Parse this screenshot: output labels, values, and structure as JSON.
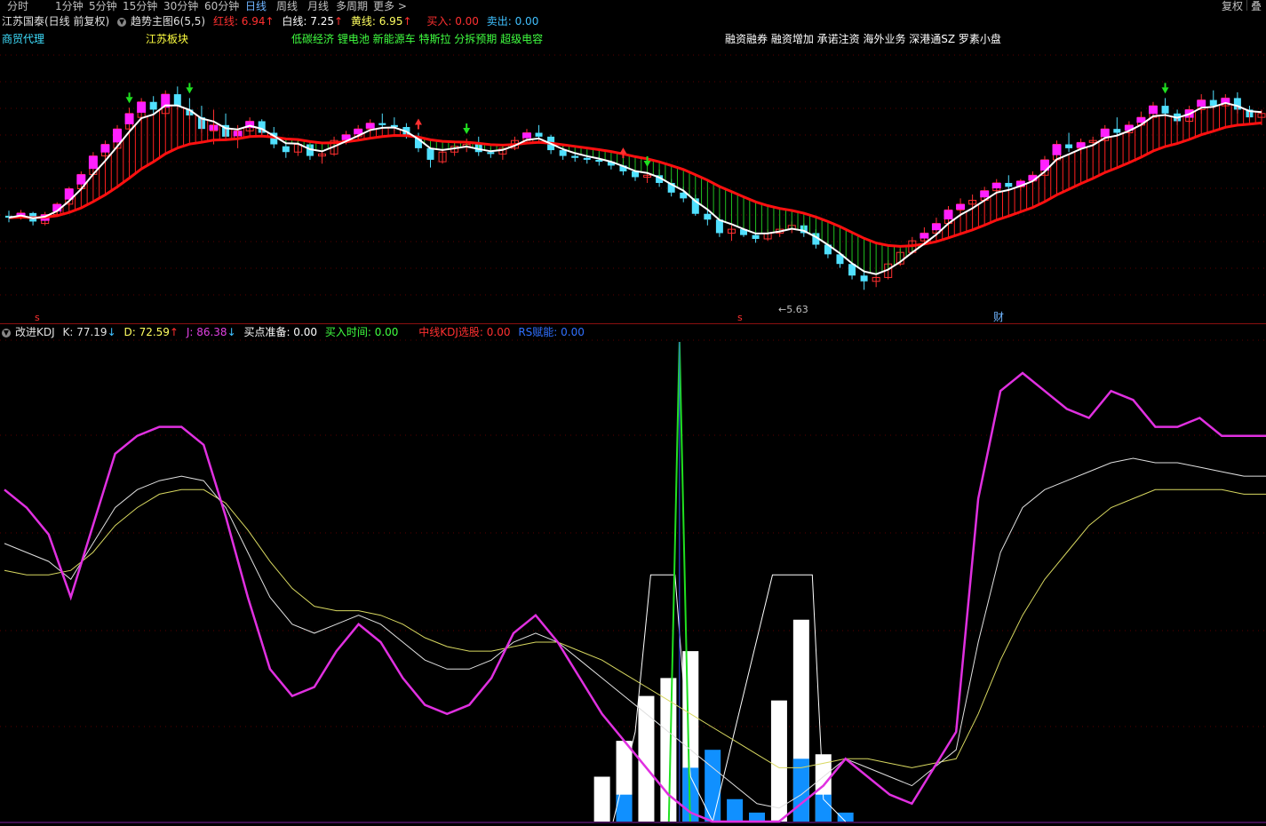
{
  "toolbar": {
    "periods": [
      "分时",
      "1分钟",
      "5分钟",
      "15分钟",
      "30分钟",
      "60分钟",
      "日线",
      "周线",
      "月线",
      "多周期",
      "更多 >"
    ],
    "active_index": 6,
    "right_buttons": [
      "复权",
      "叠"
    ]
  },
  "main": {
    "stock_title": "江苏国泰(日线 前复权)",
    "indicator_name": "趋势主图6(5,5)",
    "red_label": "红线: 6.94",
    "white_label": "白线: 7.25",
    "yellow_label": "黄线: 6.95",
    "buy_label": "买入: 0.00",
    "sell_label": "卖出: 0.00",
    "tags": [
      {
        "text": "商贸代理",
        "color": "#3fe0ff"
      },
      {
        "text": "江苏板块",
        "color": "#ffff40"
      },
      {
        "text": "低碳经济 锂电池 新能源车 特斯拉 分拆预期 超级电容",
        "color": "#40ff40"
      },
      {
        "text": "融资融券 融资增加 承诺注资 海外业务 深港通SZ 罗素小盘",
        "color": "#ffffff"
      }
    ],
    "low_price_label": "←5.63",
    "s_marks": [
      "s",
      "s"
    ],
    "cai_mark": "财"
  },
  "sub": {
    "indicator_name": "改进KDJ",
    "k_label": "K: 77.19",
    "d_label": "D: 72.59",
    "j_label": "J: 86.38",
    "buy_prep_label": "买点准备: 0.00",
    "buy_time_label": "买入时间: 0.00",
    "mid_kdj_label": "中线KDJ选股: 0.00",
    "rs_label": "RS赋能: 0.00"
  },
  "colors": {
    "up": "#ff3030",
    "down": "#50e0ff",
    "white_line": "#ffffff",
    "red_ma": "#ff1010",
    "magenta": "#ff20ff",
    "j_line": "#e030e0",
    "d_line": "#d8d860",
    "k_line": "#e0e0e0",
    "blue_bar": "#1090ff",
    "green_spike": "#20e020"
  },
  "chart_data": {
    "type": "candlestick",
    "ohlc": [
      [
        7.55,
        7.68,
        7.38,
        7.5
      ],
      [
        7.5,
        7.7,
        7.45,
        7.62
      ],
      [
        7.62,
        7.65,
        7.3,
        7.4
      ],
      [
        7.35,
        7.65,
        7.3,
        7.58
      ],
      [
        7.58,
        7.9,
        7.52,
        7.85
      ],
      [
        7.85,
        8.3,
        7.8,
        8.25
      ],
      [
        8.25,
        8.7,
        8.2,
        8.62
      ],
      [
        8.62,
        9.2,
        8.55,
        9.1
      ],
      [
        9.1,
        9.5,
        8.9,
        9.4
      ],
      [
        9.3,
        9.9,
        9.2,
        9.8
      ],
      [
        9.8,
        10.35,
        9.7,
        10.2
      ],
      [
        10.1,
        10.6,
        9.95,
        10.5
      ],
      [
        10.5,
        10.65,
        10.2,
        10.3
      ],
      [
        10.2,
        10.8,
        10.1,
        10.7
      ],
      [
        10.7,
        10.9,
        10.3,
        10.4
      ],
      [
        10.3,
        10.6,
        10.05,
        10.15
      ],
      [
        10.1,
        10.4,
        9.7,
        9.8
      ],
      [
        9.75,
        10.3,
        9.4,
        9.9
      ],
      [
        9.9,
        10.2,
        9.5,
        9.6
      ],
      [
        9.55,
        9.9,
        9.3,
        9.75
      ],
      [
        9.75,
        10.1,
        9.7,
        10.0
      ],
      [
        10.0,
        10.05,
        9.6,
        9.7
      ],
      [
        9.7,
        9.85,
        9.3,
        9.4
      ],
      [
        9.35,
        9.5,
        9.05,
        9.2
      ],
      [
        9.2,
        9.55,
        9.1,
        9.4
      ],
      [
        9.4,
        9.45,
        9.0,
        9.1
      ],
      [
        9.1,
        9.25,
        8.9,
        9.15
      ],
      [
        9.15,
        9.6,
        9.1,
        9.5
      ],
      [
        9.5,
        9.75,
        9.4,
        9.65
      ],
      [
        9.6,
        9.9,
        9.55,
        9.8
      ],
      [
        9.8,
        10.05,
        9.7,
        9.95
      ],
      [
        9.95,
        10.2,
        9.8,
        9.9
      ],
      [
        9.9,
        10.1,
        9.75,
        9.85
      ],
      [
        9.85,
        9.95,
        9.55,
        9.6
      ],
      [
        9.6,
        9.7,
        9.2,
        9.3
      ],
      [
        9.3,
        9.45,
        8.8,
        9.0
      ],
      [
        8.95,
        9.3,
        8.9,
        9.2
      ],
      [
        9.2,
        9.45,
        9.1,
        9.35
      ],
      [
        9.35,
        9.55,
        9.2,
        9.4
      ],
      [
        9.4,
        9.6,
        9.1,
        9.2
      ],
      [
        9.2,
        9.3,
        9.05,
        9.15
      ],
      [
        9.15,
        9.35,
        9.0,
        9.3
      ],
      [
        9.3,
        9.6,
        9.25,
        9.5
      ],
      [
        9.5,
        9.8,
        9.45,
        9.7
      ],
      [
        9.7,
        9.9,
        9.55,
        9.6
      ],
      [
        9.6,
        9.65,
        9.15,
        9.25
      ],
      [
        9.25,
        9.35,
        9.0,
        9.1
      ],
      [
        9.1,
        9.2,
        8.95,
        9.05
      ],
      [
        9.05,
        9.15,
        8.9,
        9.0
      ],
      [
        9.0,
        9.1,
        8.85,
        8.95
      ],
      [
        8.95,
        9.0,
        8.75,
        8.85
      ],
      [
        8.85,
        8.95,
        8.6,
        8.7
      ],
      [
        8.7,
        8.8,
        8.45,
        8.55
      ],
      [
        8.55,
        8.7,
        8.4,
        8.6
      ],
      [
        8.6,
        8.75,
        8.3,
        8.4
      ],
      [
        8.4,
        8.5,
        8.05,
        8.15
      ],
      [
        8.15,
        8.3,
        7.9,
        8.0
      ],
      [
        8.0,
        8.1,
        7.55,
        7.6
      ],
      [
        7.6,
        7.7,
        7.3,
        7.45
      ],
      [
        7.45,
        7.6,
        7.0,
        7.1
      ],
      [
        7.1,
        7.3,
        6.9,
        7.2
      ],
      [
        7.2,
        7.4,
        7.0,
        7.05
      ],
      [
        7.05,
        7.15,
        6.85,
        6.95
      ],
      [
        6.95,
        7.2,
        6.9,
        7.1
      ],
      [
        7.1,
        7.3,
        7.0,
        7.2
      ],
      [
        7.2,
        7.4,
        7.1,
        7.3
      ],
      [
        7.3,
        7.35,
        7.0,
        7.1
      ],
      [
        7.1,
        7.2,
        6.7,
        6.8
      ],
      [
        6.8,
        6.9,
        6.45,
        6.55
      ],
      [
        6.55,
        6.7,
        6.2,
        6.3
      ],
      [
        6.3,
        6.4,
        5.9,
        6.0
      ],
      [
        6.0,
        6.15,
        5.63,
        5.85
      ],
      [
        5.85,
        6.0,
        5.7,
        5.95
      ],
      [
        5.95,
        6.4,
        5.9,
        6.3
      ],
      [
        6.3,
        6.7,
        6.25,
        6.6
      ],
      [
        6.6,
        7.0,
        6.55,
        6.9
      ],
      [
        6.9,
        7.25,
        6.85,
        7.1
      ],
      [
        7.1,
        7.5,
        7.0,
        7.35
      ],
      [
        7.35,
        7.8,
        7.3,
        7.7
      ],
      [
        7.7,
        8.0,
        7.55,
        7.85
      ],
      [
        7.85,
        8.1,
        7.7,
        7.95
      ],
      [
        7.95,
        8.3,
        7.9,
        8.2
      ],
      [
        8.2,
        8.5,
        8.1,
        8.4
      ],
      [
        8.4,
        8.6,
        8.2,
        8.3
      ],
      [
        8.3,
        8.5,
        8.2,
        8.45
      ],
      [
        8.45,
        8.7,
        8.35,
        8.6
      ],
      [
        8.6,
        9.1,
        8.55,
        9.0
      ],
      [
        9.0,
        9.5,
        8.95,
        9.4
      ],
      [
        9.4,
        9.7,
        9.2,
        9.3
      ],
      [
        9.3,
        9.55,
        9.15,
        9.45
      ],
      [
        9.45,
        9.6,
        9.35,
        9.5
      ],
      [
        9.5,
        9.9,
        9.45,
        9.8
      ],
      [
        9.8,
        10.1,
        9.6,
        9.7
      ],
      [
        9.7,
        10.0,
        9.6,
        9.9
      ],
      [
        9.9,
        10.25,
        9.85,
        10.1
      ],
      [
        10.1,
        10.5,
        10.0,
        10.4
      ],
      [
        10.4,
        10.6,
        10.1,
        10.2
      ],
      [
        10.2,
        10.3,
        9.9,
        10.0
      ],
      [
        10.0,
        10.4,
        9.95,
        10.3
      ],
      [
        10.3,
        10.7,
        10.2,
        10.55
      ],
      [
        10.55,
        10.8,
        10.3,
        10.4
      ],
      [
        10.4,
        10.7,
        10.35,
        10.6
      ],
      [
        10.6,
        10.75,
        10.2,
        10.3
      ],
      [
        10.3,
        10.4,
        10.0,
        10.1
      ],
      [
        10.1,
        10.3,
        9.9,
        10.2
      ]
    ],
    "price_low_label": 5.63,
    "kdj": {
      "K": [
        62,
        60,
        58,
        54,
        62,
        70,
        74,
        76,
        77,
        76,
        70,
        60,
        50,
        44,
        42,
        44,
        46,
        44,
        40,
        36,
        34,
        34,
        36,
        40,
        42,
        40,
        36,
        32,
        28,
        24,
        20,
        16,
        12,
        8,
        4,
        3,
        6,
        10,
        14,
        12,
        10,
        8,
        12,
        16,
        40,
        60,
        70,
        74,
        76,
        78,
        80,
        81,
        80,
        80,
        79,
        78,
        77,
        77
      ],
      "D": [
        56,
        55,
        55,
        56,
        60,
        66,
        70,
        73,
        74,
        74,
        71,
        65,
        58,
        52,
        48,
        47,
        47,
        46,
        44,
        41,
        39,
        38,
        38,
        39,
        40,
        40,
        38,
        36,
        33,
        30,
        27,
        24,
        21,
        18,
        15,
        12,
        12,
        13,
        14,
        14,
        13,
        12,
        13,
        14,
        24,
        36,
        46,
        54,
        60,
        66,
        70,
        72,
        74,
        74,
        74,
        74,
        73,
        73
      ],
      "J": [
        74,
        70,
        64,
        50,
        66,
        82,
        86,
        88,
        88,
        84,
        68,
        50,
        34,
        28,
        30,
        38,
        44,
        40,
        32,
        26,
        24,
        26,
        32,
        42,
        46,
        40,
        32,
        24,
        18,
        12,
        6,
        2,
        0,
        0,
        0,
        0,
        4,
        8,
        14,
        10,
        6,
        4,
        12,
        20,
        72,
        96,
        100,
        96,
        92,
        90,
        96,
        94,
        88,
        88,
        90,
        86,
        86,
        86
      ]
    }
  }
}
